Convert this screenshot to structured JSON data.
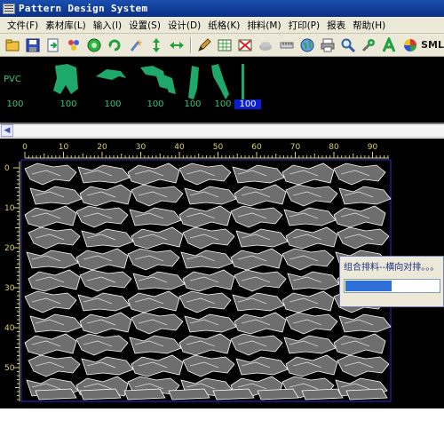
{
  "window": {
    "title": "Pattern Design System"
  },
  "menu": [
    "文件(F)",
    "素材库(L)",
    "输入(I)",
    "设置(S)",
    "设计(D)",
    "纸格(K)",
    "排料(M)",
    "打印(P)",
    "报表",
    "帮助(H)"
  ],
  "toolbar": {
    "icons": [
      "open-icon",
      "save-icon",
      "import-icon",
      "palette-icon",
      "green-circle-icon",
      "refresh-icon",
      "wand-icon",
      "move-vertical-icon",
      "move-horizontal-icon",
      "pencil-icon",
      "grid-icon",
      "delete-grid-icon",
      "cloud-icon",
      "ruler-icon",
      "globe-icon",
      "printer-icon",
      "search-icon",
      "wrench-icon",
      "letter-a-icon",
      "color-wheel-icon"
    ],
    "sml_label": "SML"
  },
  "pieces_panel": {
    "material": "PVC",
    "counts": [
      "100",
      "100",
      "100",
      "100",
      "100",
      "100",
      "100"
    ],
    "selected_index": 6
  },
  "canvas": {
    "x_ticks": [
      "0",
      "10",
      "20",
      "30",
      "40",
      "50",
      "60",
      "70",
      "80",
      "90"
    ],
    "y_ticks": [
      "0",
      "10",
      "20",
      "30",
      "40",
      "50"
    ],
    "colors": {
      "background": "#000000",
      "ruler": "#d8d26a",
      "piece_fill": "#6e6e6e",
      "piece_stroke": "#ffffff",
      "border": "#2b2bd0"
    }
  },
  "progress": {
    "title": "组合排料--横向对排。。。",
    "percent": 50
  }
}
